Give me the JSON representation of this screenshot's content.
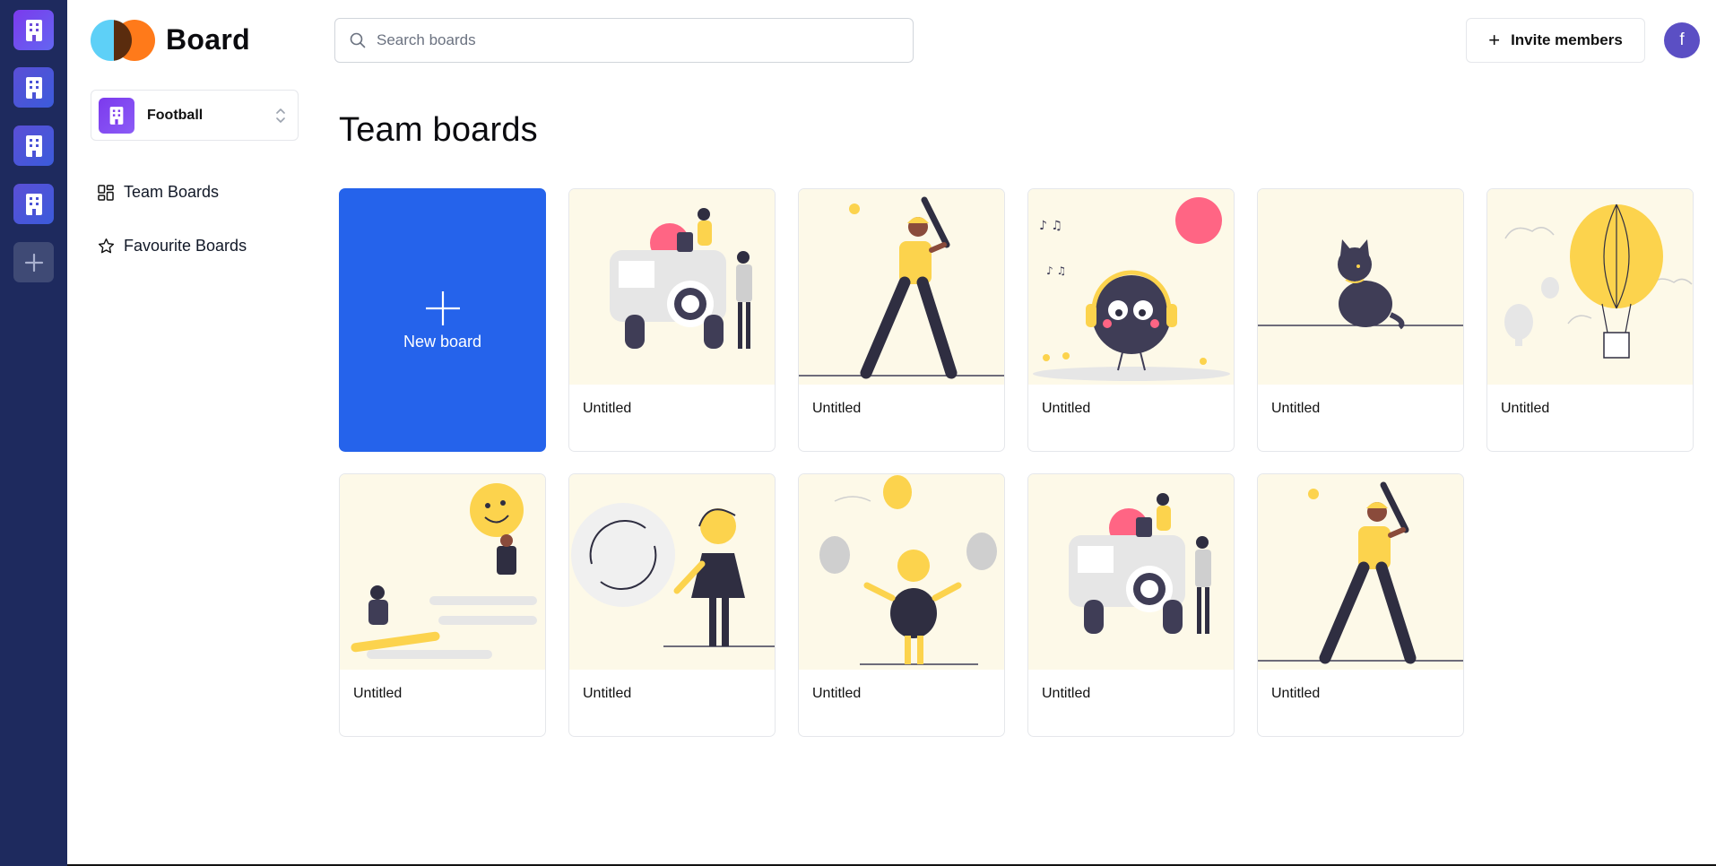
{
  "app": {
    "name": "Board"
  },
  "rail": {
    "orgs": [
      {
        "name": "org-1"
      },
      {
        "name": "org-2"
      },
      {
        "name": "org-3"
      },
      {
        "name": "org-4"
      }
    ],
    "add_icon": "plus-icon"
  },
  "sidebar": {
    "org_switcher": {
      "name": "Football"
    },
    "items": [
      {
        "label": "Team Boards",
        "icon": "grid-icon"
      },
      {
        "label": "Favourite Boards",
        "icon": "star-icon"
      }
    ]
  },
  "header": {
    "search_placeholder": "Search boards",
    "invite_label": "Invite members",
    "avatar_initial": "f"
  },
  "main": {
    "title": "Team boards",
    "new_board_label": "New board",
    "boards": [
      {
        "title": "Untitled",
        "art": "jeep-people"
      },
      {
        "title": "Untitled",
        "art": "baseball-batter"
      },
      {
        "title": "Untitled",
        "art": "music-bird"
      },
      {
        "title": "Untitled",
        "art": "black-cat"
      },
      {
        "title": "Untitled",
        "art": "hot-air-balloon"
      },
      {
        "title": "Untitled",
        "art": "emoji-balloon"
      },
      {
        "title": "Untitled",
        "art": "refresh-woman"
      },
      {
        "title": "Untitled",
        "art": "balloons-kid"
      },
      {
        "title": "Untitled",
        "art": "jeep-people"
      },
      {
        "title": "Untitled",
        "art": "baseball-batter"
      }
    ]
  },
  "colors": {
    "rail_bg": "#1e2a5e",
    "primary": "#2563eb",
    "accent_yellow": "#fcd34d",
    "accent_pink": "#ff6584",
    "art_bg": "#fdf9e8"
  }
}
